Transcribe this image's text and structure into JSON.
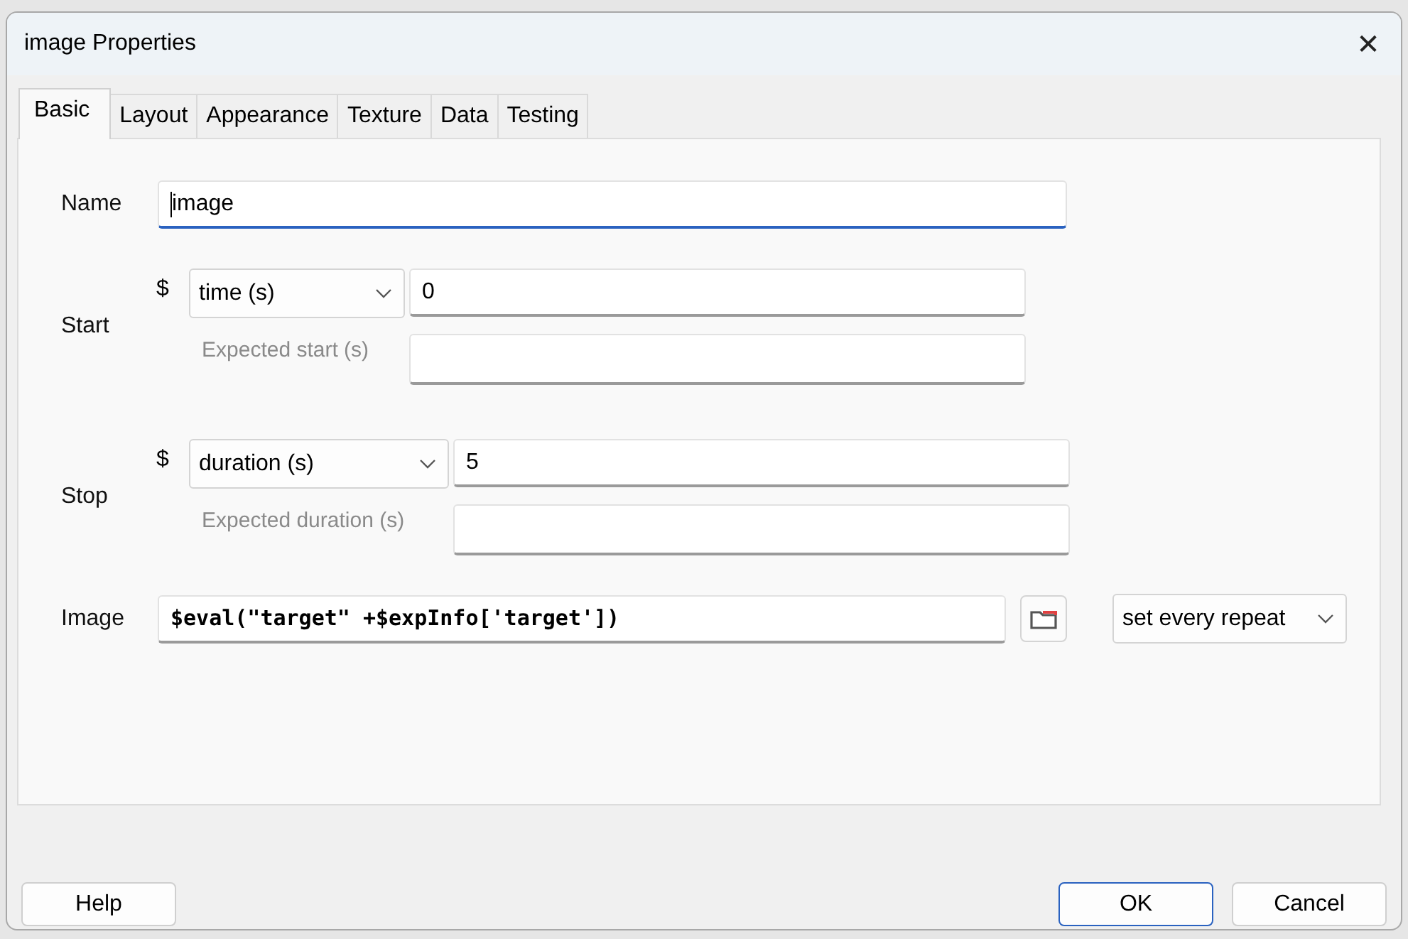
{
  "window": {
    "title": "image Properties",
    "close": "✕"
  },
  "tabs": [
    {
      "label": "Basic",
      "selected": true
    },
    {
      "label": "Layout",
      "selected": false
    },
    {
      "label": "Appearance",
      "selected": false
    },
    {
      "label": "Texture",
      "selected": false
    },
    {
      "label": "Data",
      "selected": false
    },
    {
      "label": "Testing",
      "selected": false
    }
  ],
  "name": {
    "label": "Name",
    "value": "image",
    "focused": true
  },
  "start": {
    "label": "Start",
    "prefix": "$",
    "type": "time (s)",
    "value": "0",
    "expected_label": "Expected start (s)"
  },
  "stop": {
    "label": "Stop",
    "prefix": "$",
    "type": "duration (s)",
    "value": "5",
    "expected_label": "Expected duration (s)"
  },
  "image": {
    "label": "Image",
    "value": "$eval(\"target\" +$expInfo['target'])",
    "update": "set every repeat"
  },
  "help_button": {
    "label": "Help",
    "default": false
  },
  "buttons": [
    {
      "label": "OK",
      "default": true
    },
    {
      "label": "Cancel",
      "default": false
    }
  ]
}
